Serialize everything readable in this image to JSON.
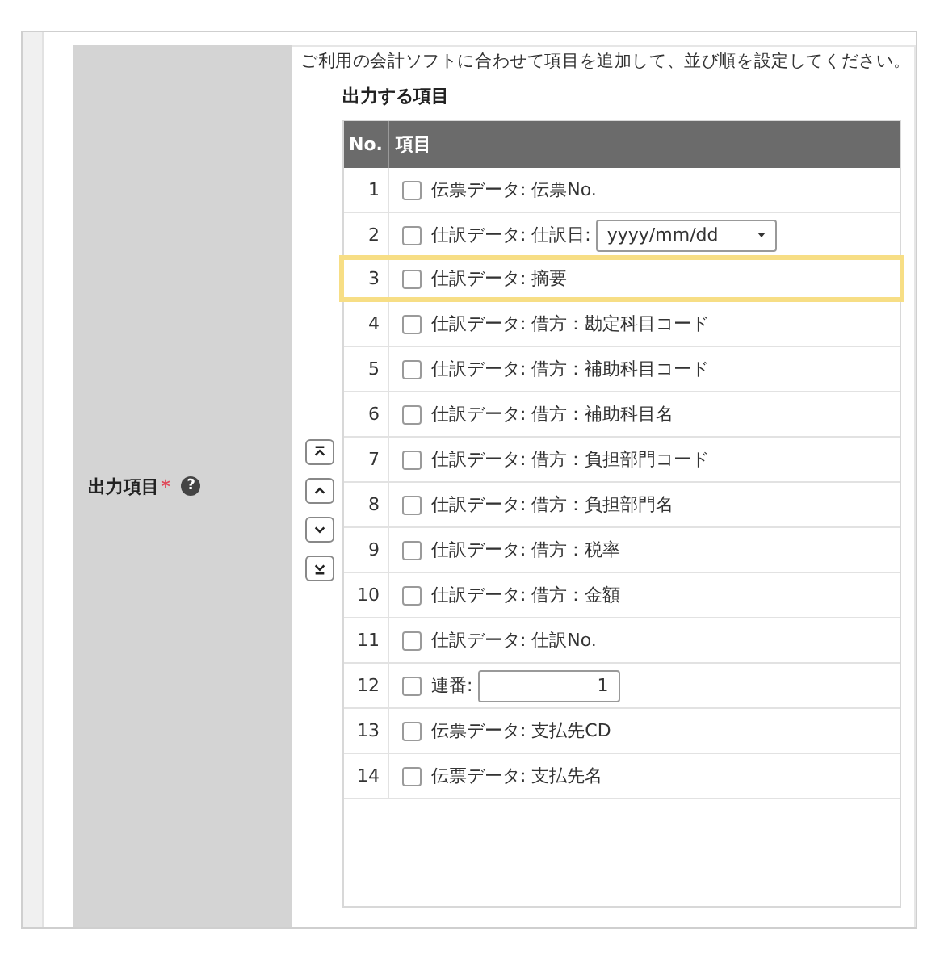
{
  "field": {
    "label": "出力項目",
    "required_mark": "*",
    "help_mark": "?"
  },
  "description": "ご利用の会計ソフトに合わせて項目を追加して、並び順を設定してください。",
  "list_title": "出力する項目",
  "move_buttons": [
    {
      "kind": "top"
    },
    {
      "kind": "up"
    },
    {
      "kind": "down"
    },
    {
      "kind": "bottom"
    }
  ],
  "table": {
    "columns": [
      "No.",
      "項目"
    ],
    "items": [
      {
        "no": "1",
        "label": "伝票データ: 伝票No.",
        "checked": false,
        "selected": false,
        "kind": "plain"
      },
      {
        "no": "2",
        "label": "仕訳データ: 仕訳日:",
        "checked": false,
        "selected": false,
        "kind": "date",
        "value": "yyyy/mm/dd"
      },
      {
        "no": "3",
        "label": "仕訳データ: 摘要",
        "checked": false,
        "selected": true,
        "kind": "plain"
      },
      {
        "no": "4",
        "label": "仕訳データ: 借方：勘定科目コード",
        "checked": false,
        "selected": false,
        "kind": "plain"
      },
      {
        "no": "5",
        "label": "仕訳データ: 借方：補助科目コード",
        "checked": false,
        "selected": false,
        "kind": "plain"
      },
      {
        "no": "6",
        "label": "仕訳データ: 借方：補助科目名",
        "checked": false,
        "selected": false,
        "kind": "plain"
      },
      {
        "no": "7",
        "label": "仕訳データ: 借方：負担部門コード",
        "checked": false,
        "selected": false,
        "kind": "plain"
      },
      {
        "no": "8",
        "label": "仕訳データ: 借方：負担部門名",
        "checked": false,
        "selected": false,
        "kind": "plain"
      },
      {
        "no": "9",
        "label": "仕訳データ: 借方：税率",
        "checked": false,
        "selected": false,
        "kind": "plain"
      },
      {
        "no": "10",
        "label": "仕訳データ: 借方：金額",
        "checked": false,
        "selected": false,
        "kind": "plain"
      },
      {
        "no": "11",
        "label": "仕訳データ: 仕訳No.",
        "checked": false,
        "selected": false,
        "kind": "plain"
      },
      {
        "no": "12",
        "label": "連番:",
        "checked": false,
        "selected": false,
        "kind": "number",
        "value": "1"
      },
      {
        "no": "13",
        "label": "伝票データ: 支払先CD",
        "checked": false,
        "selected": false,
        "kind": "plain"
      },
      {
        "no": "14",
        "label": "伝票データ: 支払先名",
        "checked": false,
        "selected": false,
        "kind": "plain"
      }
    ]
  }
}
